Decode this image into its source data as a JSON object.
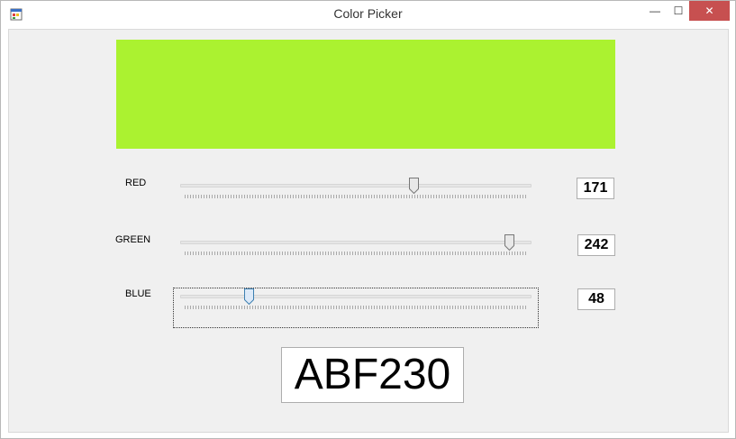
{
  "window": {
    "title": "Color Picker",
    "controls": {
      "minimize": "—",
      "maximize": "☐",
      "close": "✕"
    }
  },
  "preview": {
    "color": "#ABF230"
  },
  "sliders": [
    {
      "label": "RED",
      "value": "171",
      "fraction": 0.6706,
      "focused": false
    },
    {
      "label": "GREEN",
      "value": "242",
      "fraction": 0.949,
      "focused": false
    },
    {
      "label": "BLUE",
      "value": "48",
      "fraction": 0.1882,
      "focused": true
    }
  ],
  "hex": {
    "value": "ABF230"
  },
  "colors": {
    "thumb_normal": "#e8e8e8",
    "thumb_focused": "#dce9f8",
    "thumb_focused_border": "#3c7fb1",
    "close_button": "#c75050"
  },
  "icons": {
    "app": "window-app-icon",
    "minimize": "minimize-icon",
    "maximize": "maximize-icon",
    "close": "close-icon"
  }
}
